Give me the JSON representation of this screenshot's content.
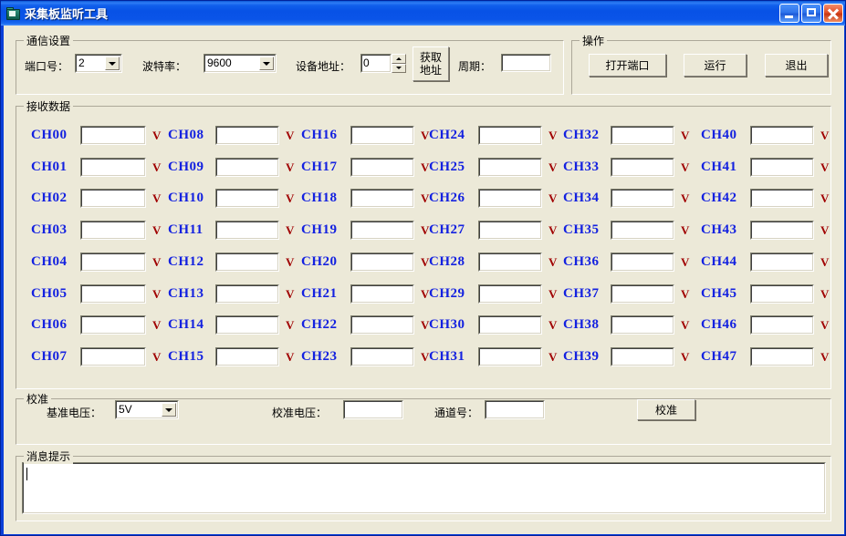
{
  "window": {
    "title": "采集板监听工具",
    "icon": "folder-icon",
    "minimize_label": "最小化",
    "maximize_label": "最大化",
    "close_label": "关闭",
    "bg_color": "#ece9d8",
    "title_color": "#0a54e8"
  },
  "comm_settings": {
    "title": "通信设置",
    "port_label": "端口号：",
    "port_value": "2",
    "baud_label": "波特率：",
    "baud_value": "9600",
    "addr_label": "设备地址：",
    "addr_value": "0",
    "get_addr_button": "获取\n地址",
    "period_label": "周期：",
    "period_value": ""
  },
  "operations": {
    "title": "操作",
    "open_port_button": "打开端口",
    "run_button": "运行",
    "exit_button": "退出"
  },
  "received_data": {
    "title": "接收数据",
    "label_color": "#1321e0",
    "marker_color": "#a00000",
    "marker_glyph": "V",
    "columns": [
      {
        "channels": [
          {
            "label": "CH00",
            "value": ""
          },
          {
            "label": "CH01",
            "value": ""
          },
          {
            "label": "CH02",
            "value": ""
          },
          {
            "label": "CH03",
            "value": ""
          },
          {
            "label": "CH04",
            "value": ""
          },
          {
            "label": "CH05",
            "value": ""
          },
          {
            "label": "CH06",
            "value": ""
          },
          {
            "label": "CH07",
            "value": ""
          }
        ]
      },
      {
        "channels": [
          {
            "label": "CH08",
            "value": ""
          },
          {
            "label": "CH09",
            "value": ""
          },
          {
            "label": "CH10",
            "value": ""
          },
          {
            "label": "CH11",
            "value": ""
          },
          {
            "label": "CH12",
            "value": ""
          },
          {
            "label": "CH13",
            "value": ""
          },
          {
            "label": "CH14",
            "value": ""
          },
          {
            "label": "CH15",
            "value": ""
          }
        ]
      },
      {
        "channels": [
          {
            "label": "CH16",
            "value": ""
          },
          {
            "label": "CH17",
            "value": ""
          },
          {
            "label": "CH18",
            "value": ""
          },
          {
            "label": "CH19",
            "value": ""
          },
          {
            "label": "CH20",
            "value": ""
          },
          {
            "label": "CH21",
            "value": ""
          },
          {
            "label": "CH22",
            "value": ""
          },
          {
            "label": "CH23",
            "value": ""
          }
        ]
      },
      {
        "channels": [
          {
            "label": "CH24",
            "value": ""
          },
          {
            "label": "CH25",
            "value": ""
          },
          {
            "label": "CH26",
            "value": ""
          },
          {
            "label": "CH27",
            "value": ""
          },
          {
            "label": "CH28",
            "value": ""
          },
          {
            "label": "CH29",
            "value": ""
          },
          {
            "label": "CH30",
            "value": ""
          },
          {
            "label": "CH31",
            "value": ""
          }
        ]
      },
      {
        "channels": [
          {
            "label": "CH32",
            "value": ""
          },
          {
            "label": "CH33",
            "value": ""
          },
          {
            "label": "CH34",
            "value": ""
          },
          {
            "label": "CH35",
            "value": ""
          },
          {
            "label": "CH36",
            "value": ""
          },
          {
            "label": "CH37",
            "value": ""
          },
          {
            "label": "CH38",
            "value": ""
          },
          {
            "label": "CH39",
            "value": ""
          }
        ]
      },
      {
        "channels": [
          {
            "label": "CH40",
            "value": ""
          },
          {
            "label": "CH41",
            "value": ""
          },
          {
            "label": "CH42",
            "value": ""
          },
          {
            "label": "CH43",
            "value": ""
          },
          {
            "label": "CH44",
            "value": ""
          },
          {
            "label": "CH45",
            "value": ""
          },
          {
            "label": "CH46",
            "value": ""
          },
          {
            "label": "CH47",
            "value": ""
          }
        ]
      }
    ]
  },
  "calibration": {
    "title": "校准",
    "ref_voltage_label": "基准电压：",
    "ref_voltage_value": "5V",
    "cal_voltage_label": "校准电压：",
    "cal_voltage_value": "",
    "channel_no_label": "通道号：",
    "channel_no_value": "",
    "calibrate_button": "校准"
  },
  "message": {
    "title": "消息提示",
    "content": ""
  }
}
